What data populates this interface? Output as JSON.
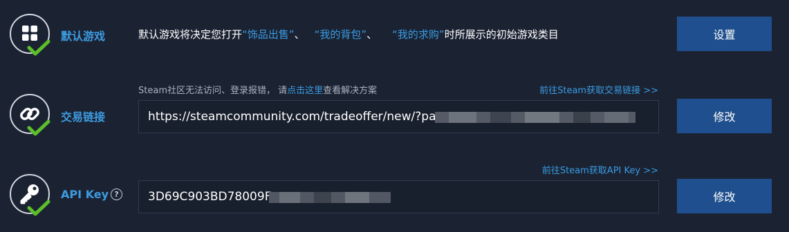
{
  "rows": [
    {
      "id": "default-game",
      "icon": "grid-icon",
      "label": "默认游戏",
      "description_parts": [
        {
          "text": "默认游戏将决定您打开",
          "highlight": false
        },
        {
          "text": "“饰品出售”",
          "highlight": true
        },
        {
          "text": "、",
          "highlight": false
        },
        {
          "text": "“我的背包”",
          "highlight": true
        },
        {
          "text": "、",
          "highlight": false
        },
        {
          "text": "“我的求购”",
          "highlight": true
        },
        {
          "text": "时所展示的初始游戏类目",
          "highlight": false
        }
      ],
      "button": "设置"
    },
    {
      "id": "trade-link",
      "icon": "link-icon",
      "label": "交易链接",
      "notice_prefix": "Steam社区无法访问、登录报错， 请",
      "notice_link": "点击这里",
      "notice_suffix": "查看解决方案",
      "external_link": "前往Steam获取交易链接 >>",
      "value": "https://steamcommunity.com/tradeoffer/new/?pa",
      "button": "修改"
    },
    {
      "id": "api-key",
      "icon": "key-icon",
      "label": "API Key",
      "help_icon": "?",
      "external_link": "前往Steam获取API Key >>",
      "value": "3D69C903BD78009F.",
      "button": "修改"
    }
  ],
  "colors": {
    "background": "#1b2333",
    "accent": "#3a9be2",
    "button": "#1f4f8e",
    "check": "#5bbf2a"
  }
}
